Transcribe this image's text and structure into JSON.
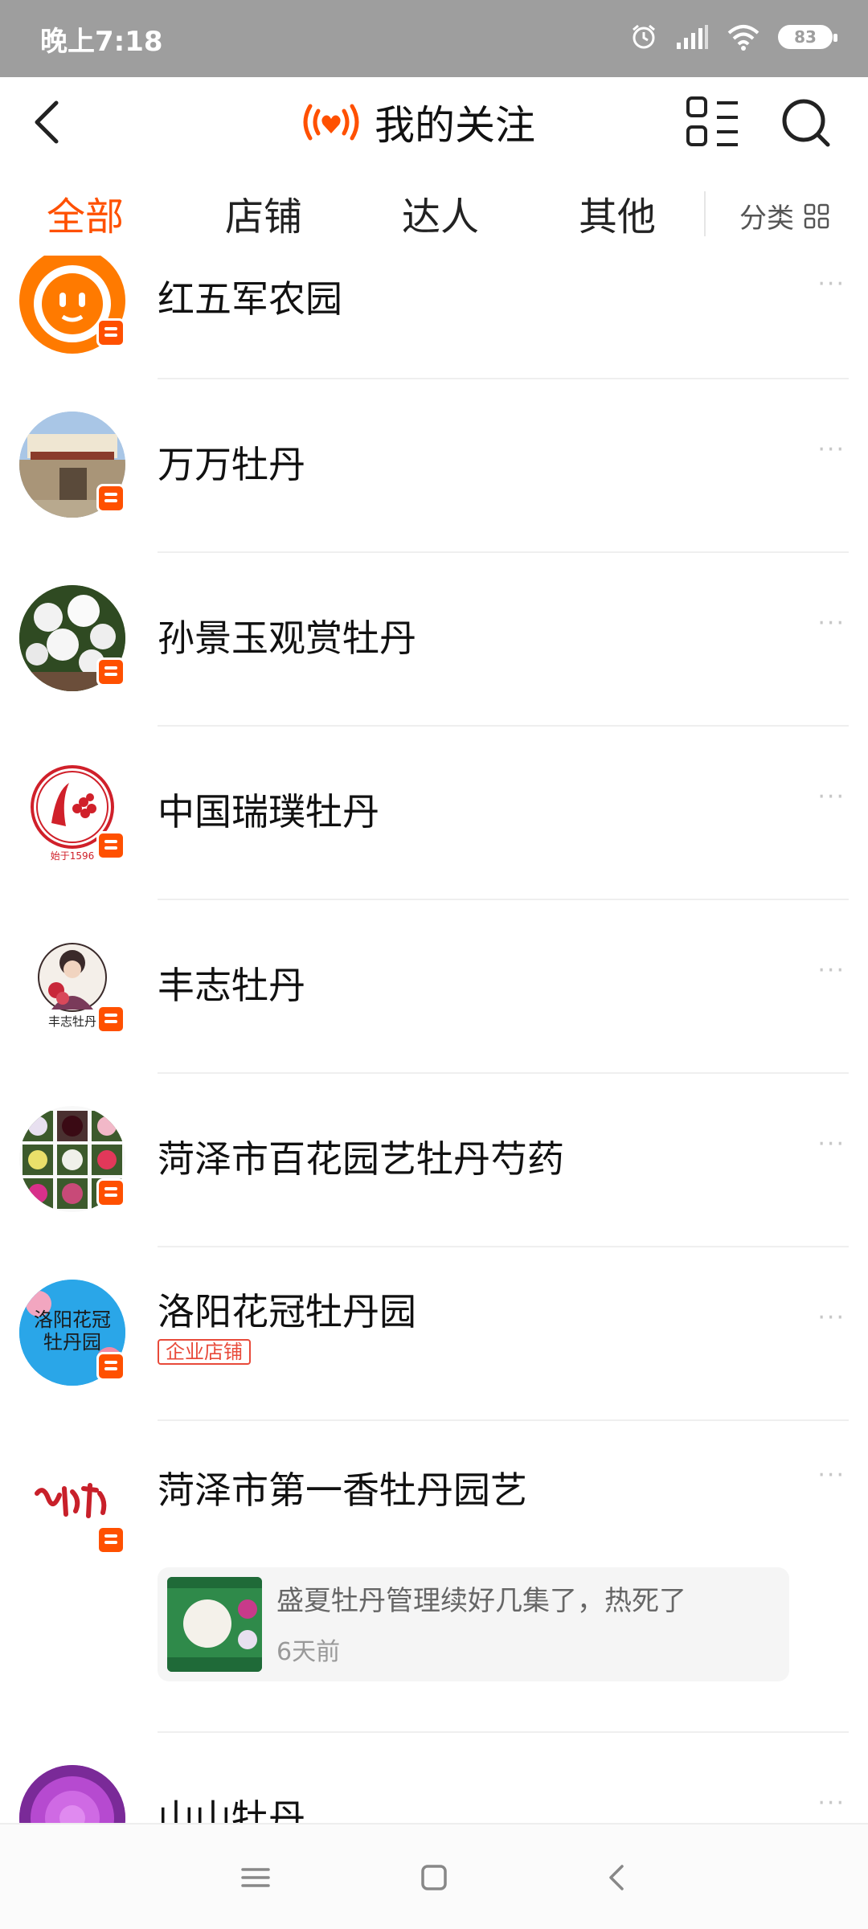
{
  "status_bar": {
    "time": "晚上7:18",
    "battery": "83"
  },
  "header": {
    "title": "我的关注",
    "accent": "#ff5000"
  },
  "tabs": [
    {
      "label": "全部",
      "active": true
    },
    {
      "label": "店铺",
      "active": false
    },
    {
      "label": "达人",
      "active": false
    },
    {
      "label": "其他",
      "active": false
    }
  ],
  "category": {
    "label": "分类"
  },
  "follow_list": [
    {
      "name": "红五军农园",
      "avatar": "orange-mascot-avatar"
    },
    {
      "name": "万万牡丹",
      "avatar": "garden-gate-photo"
    },
    {
      "name": "孙景玉观赏牡丹",
      "avatar": "white-peony-photo"
    },
    {
      "name": "中国瑞璞牡丹",
      "avatar": "red-peony-logo",
      "avatar_caption": "始于1596"
    },
    {
      "name": "丰志牡丹",
      "avatar": "woman-illustration-logo",
      "avatar_caption": "丰志牡丹"
    },
    {
      "name": "菏泽市百花园艺牡丹芍药",
      "avatar": "flower-grid-photo"
    },
    {
      "name": "洛阳花冠牡丹园",
      "avatar": "calligraphy-logo",
      "avatar_text": "洛阳花冠牡丹园",
      "tag": "企业店铺"
    },
    {
      "name": "菏泽市第一香牡丹园艺",
      "avatar": "red-calligraphy-logo",
      "post": {
        "text": "盛夏牡丹管理续好几集了，热死了",
        "time": "6天前"
      }
    },
    {
      "name": "山山牡丹",
      "avatar": "purple-peony-photo"
    }
  ],
  "more_label": "···"
}
